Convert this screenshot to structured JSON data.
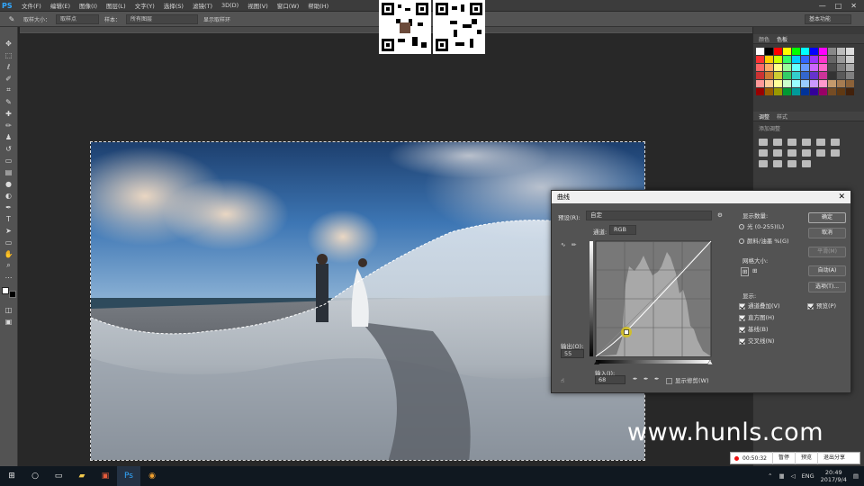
{
  "app": {
    "logo": "PS",
    "accent": "#31a8ff"
  },
  "menubar": {
    "items": [
      "文件(F)",
      "编辑(E)",
      "图像(I)",
      "图层(L)",
      "文字(Y)",
      "选择(S)",
      "滤镜(T)",
      "3D(D)",
      "视图(V)",
      "窗口(W)",
      "帮助(H)"
    ],
    "window_controls": [
      "—",
      "□",
      "✕"
    ]
  },
  "options": {
    "sample_size_label": "取样大小：",
    "sample_size_value": "取样点",
    "sample_label": "样本：",
    "sample_value": "所有图层",
    "show_ring_label": "显示取样环",
    "workspace": "基本功能"
  },
  "panels": {
    "top_tabs": [
      "颜色",
      "色板"
    ],
    "adj_tabs": [
      "调整",
      "样式"
    ],
    "adj_hint": "添加调整"
  },
  "swatches": [
    "#ffffff",
    "#000000",
    "#ff0000",
    "#ffff00",
    "#00ff00",
    "#00ffff",
    "#0000ff",
    "#ff00ff",
    "#888888",
    "#bbbbbb",
    "#dddddd",
    "#ff3333",
    "#ffcc00",
    "#ccff00",
    "#33ff66",
    "#00ccff",
    "#3366ff",
    "#9933ff",
    "#ff33cc",
    "#666666",
    "#999999",
    "#cccccc",
    "#ff6666",
    "#ffaa66",
    "#ffff88",
    "#99ff99",
    "#66ffff",
    "#6699ff",
    "#cc66ff",
    "#ff66cc",
    "#4d4d4d",
    "#7a7a7a",
    "#aaaaaa",
    "#cc3333",
    "#cc7a33",
    "#cccc33",
    "#33cc66",
    "#33cccc",
    "#3366cc",
    "#6633cc",
    "#cc3399",
    "#333333",
    "#5a5a5a",
    "#808080",
    "#ff9999",
    "#ffcc99",
    "#ffff99",
    "#ccffcc",
    "#99ffff",
    "#99ccff",
    "#cc99ff",
    "#ff99cc",
    "#c49a6c",
    "#a67c52",
    "#8c6239",
    "#990000",
    "#995c00",
    "#999900",
    "#009933",
    "#009999",
    "#003399",
    "#330099",
    "#990066",
    "#754c24",
    "#603913",
    "#42210b"
  ],
  "curves": {
    "title": "曲线",
    "preset_label": "预设(R):",
    "preset_value": "自定",
    "channel_label": "通道:",
    "channel_value": "RGB",
    "output_label": "输出(O):",
    "output_value": "55",
    "input_label": "输入(I):",
    "input_value": "68",
    "show_clipping_label": "显示修剪(W)",
    "display_amount_label": "显示数量:",
    "light_option": "光 (0-255)(L)",
    "pigment_option": "颜料/油墨 %(G)",
    "grid_size_label": "网格大小:",
    "show_label": "显示:",
    "show_options": [
      "通道叠加(V)",
      "直方图(H)",
      "基线(B)",
      "交叉线(N)"
    ],
    "buttons": {
      "ok": "确定",
      "cancel": "取消",
      "smooth": "平滑(M)",
      "auto": "自动(A)",
      "options": "选项(T)..."
    },
    "preview_label": "预览(P)",
    "point": {
      "input": 68,
      "output": 55
    }
  },
  "recorder": {
    "time": "00:50:32",
    "pause": "暂停",
    "preview": "预览",
    "exit": "退出分享"
  },
  "taskbar": {
    "ime": "ENG",
    "time": "20:49",
    "date": "2017/9/4"
  },
  "watermark": "www.hunls.com"
}
